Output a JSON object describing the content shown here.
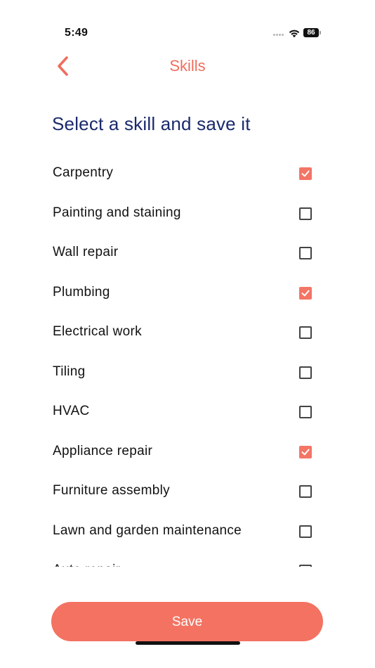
{
  "status_bar": {
    "time": "5:49",
    "battery": "86"
  },
  "nav": {
    "title": "Skills",
    "back_icon": "chevron-left-icon"
  },
  "heading": "Select a skill and save it",
  "skills": [
    {
      "label": "Carpentry",
      "checked": true
    },
    {
      "label": "Painting and staining",
      "checked": false
    },
    {
      "label": "Wall repair",
      "checked": false
    },
    {
      "label": "Plumbing",
      "checked": true
    },
    {
      "label": "Electrical work",
      "checked": false
    },
    {
      "label": "Tiling",
      "checked": false
    },
    {
      "label": "HVAC",
      "checked": false
    },
    {
      "label": "Appliance repair",
      "checked": true
    },
    {
      "label": "Furniture assembly",
      "checked": false
    },
    {
      "label": "Lawn and garden maintenance",
      "checked": false
    },
    {
      "label": "Auto repair",
      "checked": false
    }
  ],
  "save_label": "Save",
  "colors": {
    "accent": "#f37262",
    "heading": "#1a2a6b",
    "checkbox_border": "#444444"
  }
}
